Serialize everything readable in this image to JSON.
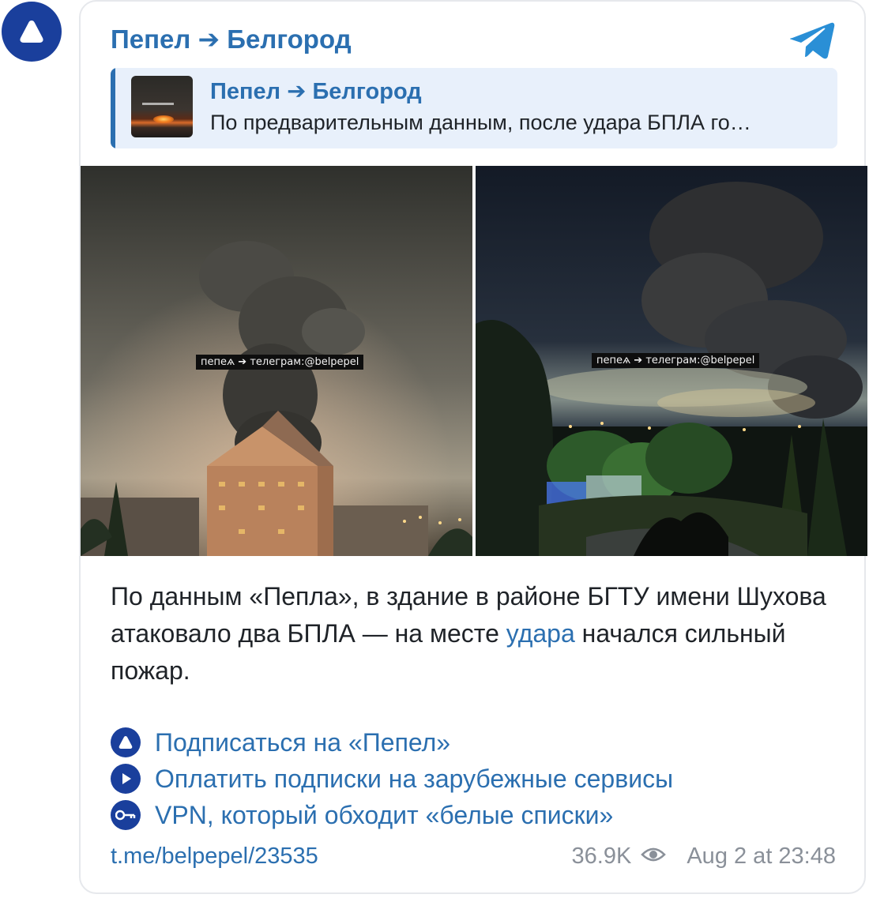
{
  "channel": {
    "name": "Пепел ➔ Белгород",
    "avatar_icon": "triangle-logo-icon",
    "brand_color": "#1a3f9c",
    "link_color": "#2b6fb0"
  },
  "reply": {
    "title": "Пепел ➔ Белгород",
    "preview_text": "По предварительным данным, после удара БПЛА го…"
  },
  "photos": [
    {
      "watermark": "пепеѧ ➔ телеграм:@belpepel"
    },
    {
      "watermark": "пепеѧ ➔ телеграм:@belpepel"
    }
  ],
  "post": {
    "text_before": "По данным «Пепла», в здание в районе БГТУ имени Шухова атаковало два БПЛА — на месте ",
    "link_text": "удара",
    "text_after": " начался сильный пожар."
  },
  "promos": [
    {
      "icon": "triangle-logo-icon",
      "label": "Подписаться на «Пепел»"
    },
    {
      "icon": "play-icon",
      "label": "Оплатить подписки на зарубежные сервисы"
    },
    {
      "icon": "key-icon",
      "label": "VPN, который обходит «белые списки»"
    }
  ],
  "footer": {
    "link": "t.me/belpepel/23535",
    "views": "36.9K",
    "views_icon": "eye-icon",
    "timestamp": "Aug 2 at 23:48"
  }
}
